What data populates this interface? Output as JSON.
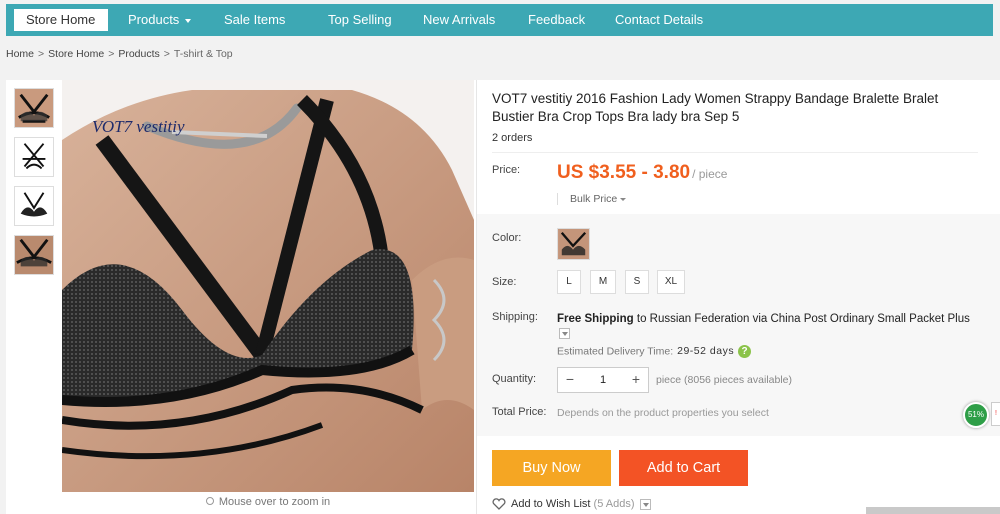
{
  "nav": {
    "items": [
      "Store Home",
      "Products",
      "Sale Items",
      "Top Selling",
      "New Arrivals",
      "Feedback",
      "Contact Details"
    ],
    "active": "Store Home",
    "bg_color": "#3da8b4"
  },
  "breadcrumb": [
    "Home",
    "Store Home",
    "Products",
    "T-shirt & Top"
  ],
  "gallery": {
    "watermark": "VOT7 vestitiy",
    "zoom_hint": "Mouse over to zoom in",
    "thumbnail_count": 4
  },
  "product": {
    "title": "VOT7 vestitiy 2016 Fashion Lady Women Strappy Bandage Bralette Bralet Bustier Bra Crop Tops Bra lady bra Sep 5",
    "orders": "2 orders",
    "price_label": "Price:",
    "price": "US $3.55 - 3.80",
    "price_unit": "/ piece",
    "bulk_price": "Bulk Price",
    "color_label": "Color:",
    "size_label": "Size:",
    "sizes": [
      "L",
      "M",
      "S",
      "XL"
    ],
    "shipping_label": "Shipping:",
    "shipping_bold": "Free Shipping",
    "shipping_text": "to Russian Federation via China Post Ordinary Small Packet Plus",
    "delivery_label": "Estimated Delivery Time:",
    "delivery_days": "29-52 days",
    "quantity_label": "Quantity:",
    "quantity": "1",
    "quantity_minus": "−",
    "quantity_plus": "+",
    "availability": "piece (8056 pieces available)",
    "total_label": "Total Price:",
    "total_note": "Depends on the product properties you select",
    "buy_now": "Buy Now",
    "add_to_cart": "Add to Cart",
    "wishlist": "Add to Wish List",
    "wishlist_count": "(5 Adds)",
    "price_color": "#f05f1e",
    "buy_color": "#f5a623",
    "cart_color": "#f35325"
  },
  "badge": {
    "text": "51%"
  },
  "edge_tab": "!"
}
